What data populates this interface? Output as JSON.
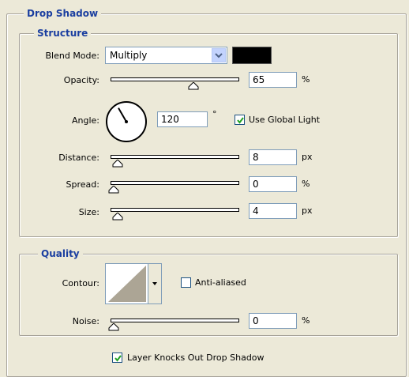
{
  "drop_shadow": {
    "title": "Drop Shadow",
    "structure": {
      "title": "Structure",
      "blend_mode": {
        "label": "Blend Mode:",
        "value": "Multiply",
        "color": "#000000"
      },
      "opacity": {
        "label": "Opacity:",
        "value": "65",
        "unit": "%",
        "slider_fraction": 0.65
      },
      "angle": {
        "label": "Angle:",
        "value": "120",
        "unit": "°",
        "degrees": 120
      },
      "use_global_light": {
        "label": "Use Global Light",
        "checked": true
      },
      "distance": {
        "label": "Distance:",
        "value": "8",
        "unit": "px",
        "slider_fraction": 0.03
      },
      "spread": {
        "label": "Spread:",
        "value": "0",
        "unit": "%",
        "slider_fraction": 0.0
      },
      "size": {
        "label": "Size:",
        "value": "4",
        "unit": "px",
        "slider_fraction": 0.03
      }
    },
    "quality": {
      "title": "Quality",
      "contour": {
        "label": "Contour:",
        "icon": "linear-contour-icon"
      },
      "anti_aliased": {
        "label": "Anti-aliased",
        "checked": false
      },
      "noise": {
        "label": "Noise:",
        "value": "0",
        "unit": "%",
        "slider_fraction": 0.0
      }
    },
    "layer_knocks_out": {
      "label": "Layer Knocks Out Drop Shadow",
      "checked": true
    }
  }
}
